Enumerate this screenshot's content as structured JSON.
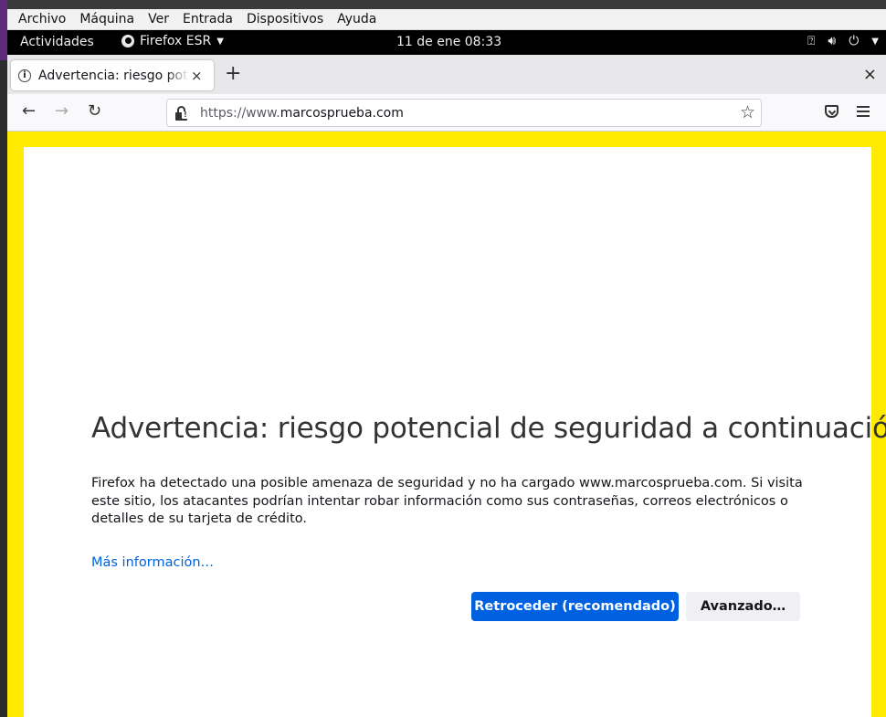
{
  "vm_menu": {
    "items": [
      "Archivo",
      "Máquina",
      "Ver",
      "Entrada",
      "Dispositivos",
      "Ayuda"
    ]
  },
  "gnome_bar": {
    "activities": "Actividades",
    "app_name": "Firefox ESR",
    "clock": "11 de ene  08:33",
    "tray_icons": [
      "accessibility-icon",
      "volume-icon",
      "power-icon"
    ]
  },
  "browser": {
    "tab": {
      "title": "Advertencia: riesgo potencial de seguridad a continuación",
      "close": "×"
    },
    "new_tab": "+",
    "window_close": "×",
    "nav": {
      "back": "←",
      "forward": "→",
      "reload": "↻"
    },
    "url": {
      "prefix": "https://www.",
      "domain": "marcosprueba.com"
    },
    "bookmark": "☆"
  },
  "page": {
    "headline": "Advertencia: riesgo potencial de seguridad a continuación",
    "description": "Firefox ha detectado una posible amenaza de seguridad y no ha cargado www.marcosprueba.com. Si visita este sitio, los atacantes podrían intentar robar información como sus contraseñas, correos electrónicos o detalles de su tarjeta de crédito.",
    "more_info": "Más información…",
    "go_back_button": "Retroceder (recomendado)",
    "advanced_button": "Avanzado…"
  },
  "colors": {
    "warning_border": "#ffe900",
    "primary_button": "#0061e0",
    "link": "#0061e0"
  }
}
